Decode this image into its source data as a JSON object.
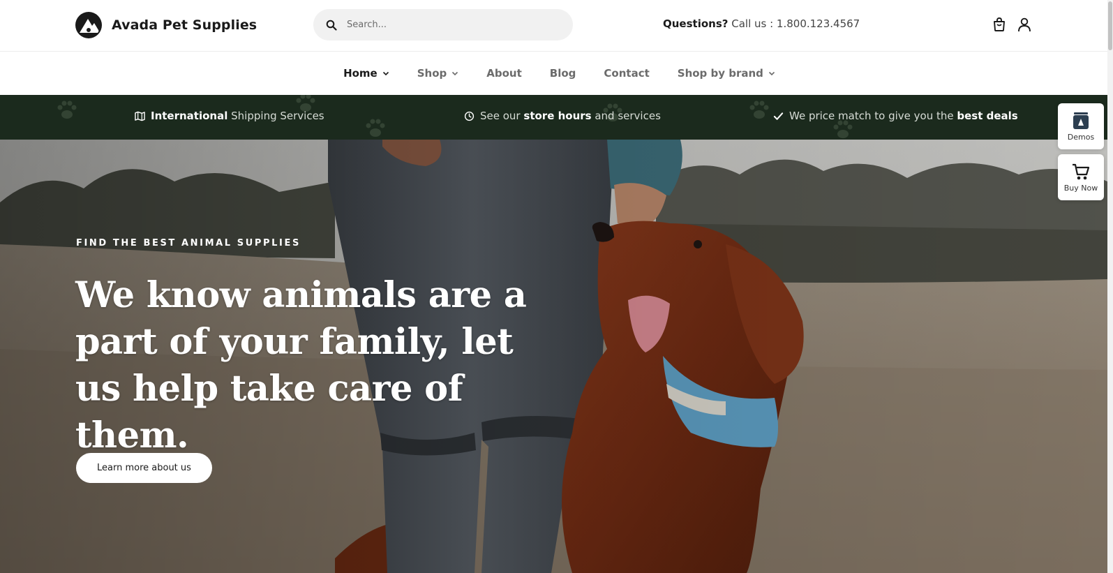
{
  "brand": {
    "name": "Avada Pet Supplies",
    "logo_icon": "paw-mountain-logo"
  },
  "search": {
    "placeholder": "Search..."
  },
  "contact": {
    "label": "Questions?",
    "text": "Call us : 1.800.123.4567"
  },
  "header_icons": [
    "cart-icon",
    "user-icon"
  ],
  "nav": {
    "items": [
      {
        "label": "Home",
        "has_dropdown": true,
        "active": true
      },
      {
        "label": "Shop",
        "has_dropdown": true,
        "active": false
      },
      {
        "label": "About",
        "has_dropdown": false,
        "active": false
      },
      {
        "label": "Blog",
        "has_dropdown": false,
        "active": false
      },
      {
        "label": "Contact",
        "has_dropdown": false,
        "active": false
      },
      {
        "label": "Shop by brand",
        "has_dropdown": true,
        "active": false
      }
    ]
  },
  "infobar": {
    "item1": {
      "bold": "International",
      "rest": "Shipping Services",
      "icon": "map-icon"
    },
    "item2": {
      "pre": "See our",
      "bold": "store hours",
      "post": "and services",
      "icon": "clock-icon"
    },
    "item3": {
      "pre": "We price match to give you the",
      "bold": "best deals",
      "icon": "check-icon"
    }
  },
  "hero": {
    "eyebrow": "FIND THE BEST ANIMAL SUPPLIES",
    "headline": "We know animals are a part of your family, let us help take care of them.",
    "cta": "Learn more about us"
  },
  "widgets": {
    "demos": "Demos",
    "buy_now": "Buy Now"
  },
  "colors": {
    "infobar_bg": "#1b2a1d",
    "text_dark": "#1a1a1a",
    "search_bg": "#f1f1f1"
  }
}
